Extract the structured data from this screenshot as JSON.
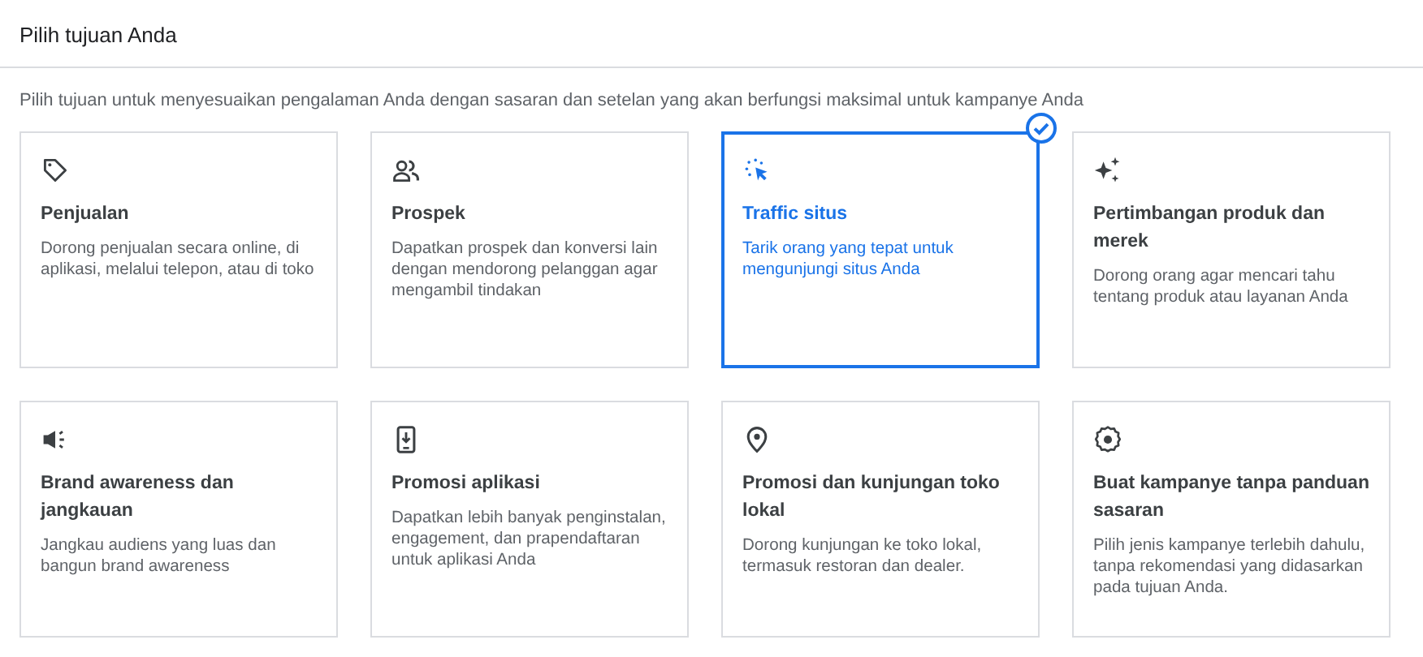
{
  "header": {
    "title": "Pilih tujuan Anda"
  },
  "subtitle": "Pilih tujuan untuk menyesuaikan pengalaman Anda dengan sasaran dan setelan yang akan berfungsi maksimal untuk kampanye Anda",
  "goals": [
    {
      "title": "Penjualan",
      "description": "Dorong penjualan secara online, di aplikasi, melalui telepon, atau di toko",
      "selected": false
    },
    {
      "title": "Prospek",
      "description": "Dapatkan prospek dan konversi lain dengan mendorong pelanggan agar mengambil tindakan",
      "selected": false
    },
    {
      "title": "Traffic situs",
      "description": "Tarik orang yang tepat untuk mengunjungi situs Anda",
      "selected": true
    },
    {
      "title": "Pertimbangan produk dan merek",
      "description": "Dorong orang agar mencari tahu tentang produk atau layanan Anda",
      "selected": false
    },
    {
      "title": "Brand awareness dan jangkauan",
      "description": "Jangkau audiens yang luas dan bangun brand awareness",
      "selected": false
    },
    {
      "title": "Promosi aplikasi",
      "description": "Dapatkan lebih banyak penginstalan, engagement, dan prapendaftaran untuk aplikasi Anda",
      "selected": false
    },
    {
      "title": "Promosi dan kunjungan toko lokal",
      "description": "Dorong kunjungan ke toko lokal, termasuk restoran dan dealer.",
      "selected": false
    },
    {
      "title": "Buat kampanye tanpa panduan sasaran",
      "description": "Pilih jenis kampanye terlebih dahulu, tanpa rekomendasi yang didasarkan pada tujuan Anda.",
      "selected": false
    }
  ]
}
